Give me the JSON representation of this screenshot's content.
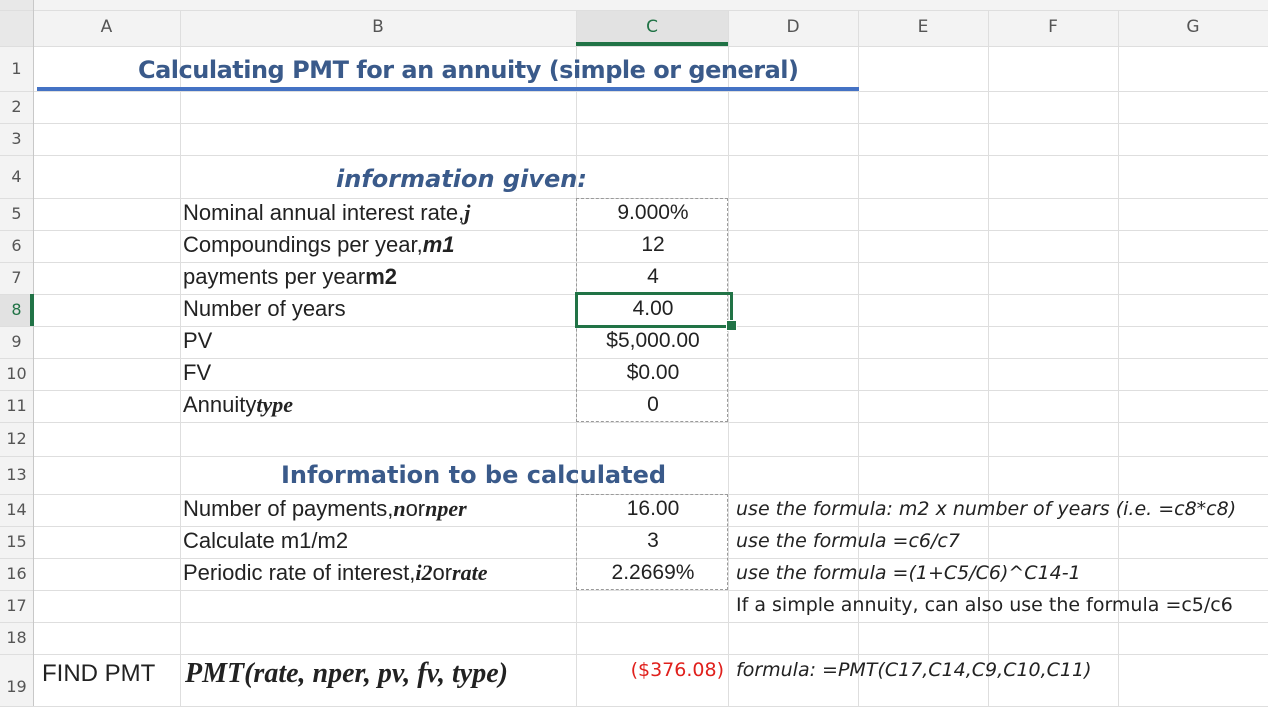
{
  "columns": [
    "A",
    "B",
    "C",
    "D",
    "E",
    "F",
    "G"
  ],
  "rows": [
    "1",
    "2",
    "3",
    "4",
    "5",
    "6",
    "7",
    "8",
    "9",
    "10",
    "11",
    "12",
    "13",
    "14",
    "15",
    "16",
    "17",
    "18",
    "19"
  ],
  "title": "Calculating PMT for an annuity (simple or general)",
  "given_heading": "information given:",
  "given": [
    {
      "label": "Nominal annual interest rate,",
      "var": "j",
      "value": "9.000%"
    },
    {
      "label": "Compoundings per year,",
      "var": "m1",
      "value": "12"
    },
    {
      "label": "payments per year",
      "var": "m2",
      "value": "4"
    },
    {
      "label": "Number of years",
      "var": "",
      "value": "4.00"
    },
    {
      "label": "PV",
      "var": "",
      "value": "$5,000.00"
    },
    {
      "label": "FV",
      "var": "",
      "value": "$0.00"
    },
    {
      "label": "Annuity",
      "var": "type",
      "value": "0"
    }
  ],
  "calc_heading": "Information to be calculated",
  "calc": [
    {
      "label": "Number of payments,",
      "var1": "n",
      "or": "or",
      "var2": "nper",
      "value": "16.00",
      "note": "use the formula: m2 x number of years (i.e. =c8*c8)"
    },
    {
      "label": "Calculate m1/m2",
      "value": "3",
      "note": "use the formula =c6/c7"
    },
    {
      "label": "Periodic rate of interest,",
      "var1": "i2",
      "or": "or",
      "var2": "rate",
      "value": "2.2669%",
      "note": "use the formula =(1+C5/C6)^C14-1"
    }
  ],
  "note_row17": "If a simple annuity, can also use the formula =c5/c6",
  "find": {
    "label": "FIND PMT",
    "formula_display": "PMT(rate, nper, pv, fv, type)",
    "result": "($376.08)",
    "result_color": "#e0201c",
    "note": "formula: =PMT(C17,C14,C9,C10,C11)"
  },
  "colors": {
    "title": "#3a5a8a",
    "accent_line": "#4472c4",
    "selection": "#217346"
  }
}
